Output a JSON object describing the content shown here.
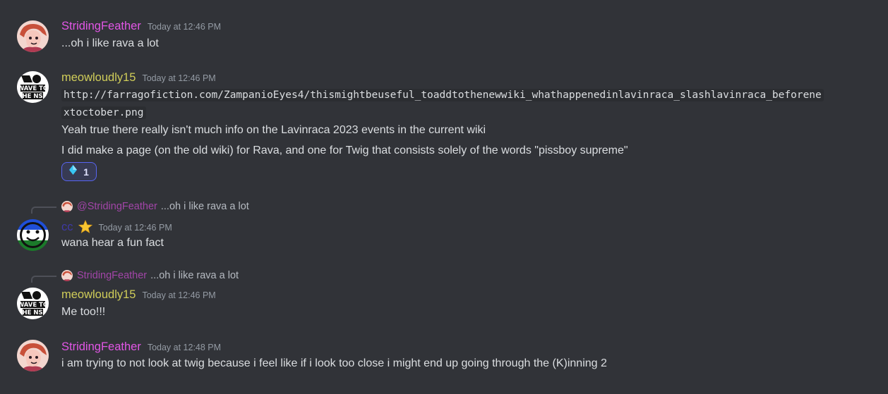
{
  "colors": {
    "background": "#313338",
    "striding_feather": "#e256e6",
    "meowloudly": "#d0cd59",
    "cc": "#3f39a6",
    "timestamp": "#949ba4",
    "reaction_border": "#5865f2"
  },
  "messages": [
    {
      "username": "StridingFeather",
      "timestamp": "Today at 12:46 PM",
      "lines": [
        "...oh i like rava a lot"
      ]
    },
    {
      "username": "meowloudly15",
      "timestamp": "Today at 12:46 PM",
      "code_line_1": "http://farragofiction.com/ZampanioEyes4/thismightbeuseful_toaddtothenewwiki_whathappenedinlavinraca_slashlavinraca_beforene",
      "code_line_2": "xtoctober.png",
      "lines": [
        "Yeah true there really isn't much info on the Lavinraca 2023 events in the current wiki",
        "I did make a page (on the old wiki) for Rava, and one for Twig that consists solely of the words \"pissboy supreme\""
      ],
      "reaction": {
        "icon": "diamond-icon",
        "count": "1"
      }
    },
    {
      "reply": {
        "name": "@StridingFeather",
        "text": "...oh i like rava a lot"
      },
      "username": "cc",
      "badge_icon": "star-icon",
      "timestamp": "Today at 12:46 PM",
      "lines": [
        "wana hear a fun fact"
      ]
    },
    {
      "reply": {
        "name": "StridingFeather",
        "text": "...oh i like rava a lot"
      },
      "username": "meowloudly15",
      "timestamp": "Today at 12:46 PM",
      "lines": [
        "Me too!!!"
      ]
    },
    {
      "username": "StridingFeather",
      "timestamp": "Today at 12:48 PM",
      "lines": [
        "i am trying to not look at twig because i feel like if i look too close i might end up going through the (K)inning 2"
      ]
    }
  ]
}
